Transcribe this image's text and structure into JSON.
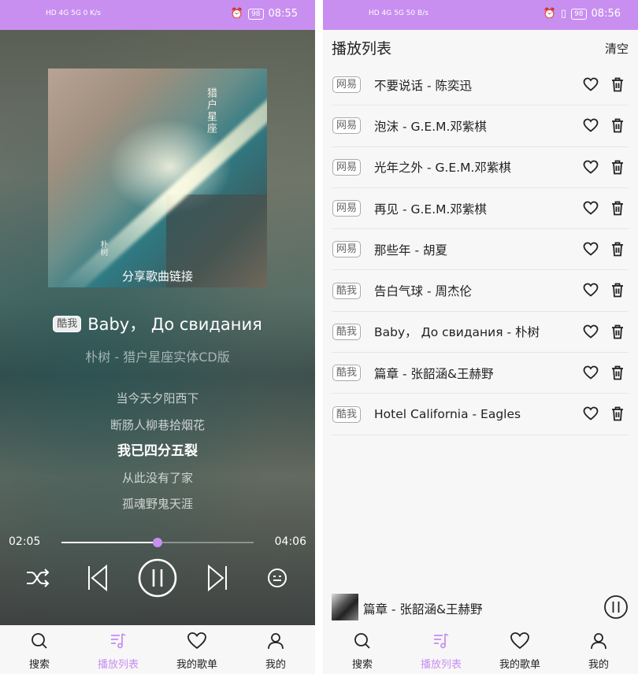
{
  "left_status": {
    "left_text": "HD 4G 5G 0 K/s",
    "battery": "98",
    "time": "08:55"
  },
  "right_status": {
    "left_text": "HD 4G 5G 50 B/s",
    "battery": "98",
    "time": "08:56"
  },
  "player": {
    "cover_text": "猎户星座",
    "cover_artist_text": "朴树",
    "share_label": "分享歌曲链接",
    "source": "酷我",
    "title": "Baby，  До свидания",
    "subtitle": "朴树 - 猎户星座实体CD版",
    "lyrics": [
      {
        "text": "当今天夕阳西下"
      },
      {
        "text": "断肠人柳巷拾烟花"
      },
      {
        "text": "我已四分五裂"
      },
      {
        "text": "从此没有了家"
      },
      {
        "text": "孤魂野鬼天涯"
      }
    ],
    "active_lyric_index": 2,
    "current_time": "02:05",
    "total_time": "04:06",
    "progress_fraction": 0.5,
    "accent_color": "#c88ff0"
  },
  "tabs": [
    {
      "label": "搜索",
      "icon": "search-icon",
      "active_left": false,
      "active_right": false
    },
    {
      "label": "播放列表",
      "icon": "playlist-music-icon",
      "active_left": true,
      "active_right": true
    },
    {
      "label": "我的歌单",
      "icon": "heart-icon",
      "active_left": false,
      "active_right": false
    },
    {
      "label": "我的",
      "icon": "user-icon",
      "active_left": false,
      "active_right": false
    }
  ],
  "playlist": {
    "title": "播放列表",
    "clear_label": "清空",
    "items": [
      {
        "source": "网易",
        "name": "不要说话 - 陈奕迅"
      },
      {
        "source": "网易",
        "name": "泡沫 - G.E.M.邓紫棋"
      },
      {
        "source": "网易",
        "name": "光年之外 - G.E.M.邓紫棋"
      },
      {
        "source": "网易",
        "name": "再见 - G.E.M.邓紫棋"
      },
      {
        "source": "网易",
        "name": "那些年 - 胡夏"
      },
      {
        "source": "酷我",
        "name": "告白气球 - 周杰伦"
      },
      {
        "source": "酷我",
        "name": "Baby，  До свидания - 朴树"
      },
      {
        "source": "酷我",
        "name": "篇章 - 张韶涵&王赫野"
      },
      {
        "source": "酷我",
        "name": "Hotel California - Eagles"
      }
    ]
  },
  "mini_player": {
    "name": "篇章 - 张韶涵&王赫野"
  }
}
